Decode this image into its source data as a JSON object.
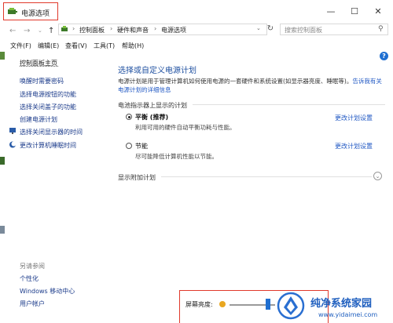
{
  "window": {
    "title": "电源选项"
  },
  "address": {
    "crumbs": [
      "控制面板",
      "硬件和声音",
      "电源选项"
    ],
    "search_placeholder": "搜索控制面板"
  },
  "menu": [
    "文件(F)",
    "编辑(E)",
    "查看(V)",
    "工具(T)",
    "帮助(H)"
  ],
  "left": {
    "home": "控制面板主页",
    "links": [
      "唤醒时需要密码",
      "选择电源按钮的功能",
      "选择关闭盖子的功能",
      "创建电源计划",
      "选择关闭显示器的时间",
      "更改计算机睡眠时间"
    ],
    "see_also": "另请参阅",
    "bottom_links": [
      "个性化",
      "Windows 移动中心",
      "用户帐户"
    ]
  },
  "main": {
    "heading": "选择或自定义电源计划",
    "desc": "电源计划是用于管理计算机如何使用电源的一套硬件和系统设置(如显示器亮度、睡眠等)。",
    "desc_link": "告诉我有关电源计划的详细信息",
    "section": "电池指示器上显示的计划",
    "plans": [
      {
        "name": "平衡 (推荐)",
        "desc": "利用可用的硬件自动平衡功耗与性能。",
        "change": "更改计划设置",
        "selected": true
      },
      {
        "name": "节能",
        "desc": "尽可能降低计算机性能以节能。",
        "change": "更改计划设置",
        "selected": false
      }
    ],
    "show_more": "显示附加计划"
  },
  "footer": {
    "brightness_label": "屏幕亮度:",
    "brightness": 0.85
  },
  "watermark": {
    "title": "纯净系统家园",
    "url": "www.yidaimei.com"
  },
  "colors": {
    "link": "#1f57c3",
    "heading": "#1e4fa0",
    "highlight": "#e0392b",
    "accent": "#1f6fd1"
  }
}
